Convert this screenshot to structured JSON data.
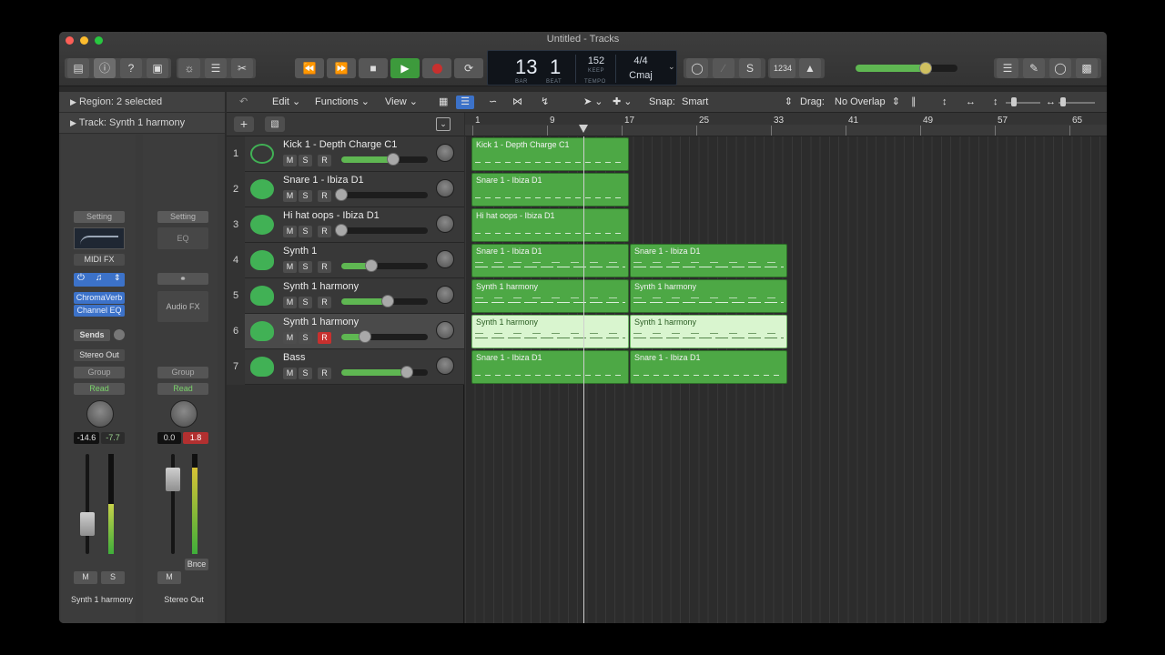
{
  "window": {
    "title": "Untitled - Tracks"
  },
  "lcd": {
    "bar": "13",
    "beat": "1",
    "bar_label": "BAR",
    "beat_label": "BEAT",
    "tempo": "152",
    "tempo_keep": "KEEP",
    "tempo_label": "TEMPO",
    "signature": "4/4",
    "key": "Cmaj"
  },
  "toolbar": {
    "count_in": "1234"
  },
  "inspector": {
    "region_label": "Region:",
    "region_value": "2 selected",
    "track_label": "Track:",
    "track_value": "Synth 1 harmony",
    "strip1": {
      "setting": "Setting",
      "midi_fx": "MIDI FX",
      "plugins": [
        "ChromaVerb",
        "Channel EQ"
      ],
      "sends": "Sends",
      "output": "Stereo Out",
      "group": "Group",
      "automation": "Read",
      "vol_db": "-14.6",
      "peak_db": "-7.7",
      "mute": "M",
      "solo": "S",
      "name": "Synth 1 harmony"
    },
    "strip2": {
      "setting": "Setting",
      "eq": "EQ",
      "audio_fx": "Audio FX",
      "group": "Group",
      "automation": "Read",
      "vol_db": "0.0",
      "peak_db": "1.8",
      "bounce": "Bnce",
      "mute": "M",
      "name": "Stereo Out"
    }
  },
  "menubar": {
    "edit": "Edit",
    "functions": "Functions",
    "view": "View",
    "snap_label": "Snap:",
    "snap_value": "Smart",
    "drag_label": "Drag:",
    "drag_value": "No Overlap"
  },
  "ruler": {
    "bars": [
      "1",
      "9",
      "17",
      "25",
      "33",
      "41",
      "49",
      "57",
      "65"
    ]
  },
  "tracks": [
    {
      "num": "1",
      "name": "Kick 1 - Depth Charge C1",
      "volume": 0.65,
      "record_armed": false
    },
    {
      "num": "2",
      "name": "Snare 1 - Ibiza D1",
      "volume": 0.0,
      "record_armed": false
    },
    {
      "num": "3",
      "name": "Hi hat oops - Ibiza D1",
      "volume": 0.0,
      "record_armed": false
    },
    {
      "num": "4",
      "name": "Synth 1",
      "volume": 0.38,
      "record_armed": false
    },
    {
      "num": "5",
      "name": "Synth 1 harmony",
      "volume": 0.58,
      "record_armed": false
    },
    {
      "num": "6",
      "name": "Synth 1 harmony",
      "volume": 0.3,
      "record_armed": true,
      "selected": true
    },
    {
      "num": "7",
      "name": "Bass",
      "volume": 0.82,
      "record_armed": false
    }
  ],
  "msr": {
    "m": "M",
    "s": "S",
    "r": "R"
  },
  "regions": {
    "r1": "Kick 1 - Depth Charge C1",
    "r2": "Snare 1 - Ibiza D1",
    "r3": "Hi hat oops - Ibiza D1",
    "r4a": "Snare 1 - Ibiza D1",
    "r4b": "Snare 1 - Ibiza D1",
    "r5a": "Synth 1 harmony",
    "r5b": "Synth 1 harmony",
    "r6a": "Synth 1 harmony",
    "r6b": "Synth 1 harmony",
    "r7a": "Snare 1 - Ibiza D1",
    "r7b": "Snare 1 - Ibiza D1"
  },
  "colors": {
    "region": "#4da845",
    "region_selected": "#d9f5cf",
    "record": "#c8302e",
    "play": "#3d9a3c"
  }
}
